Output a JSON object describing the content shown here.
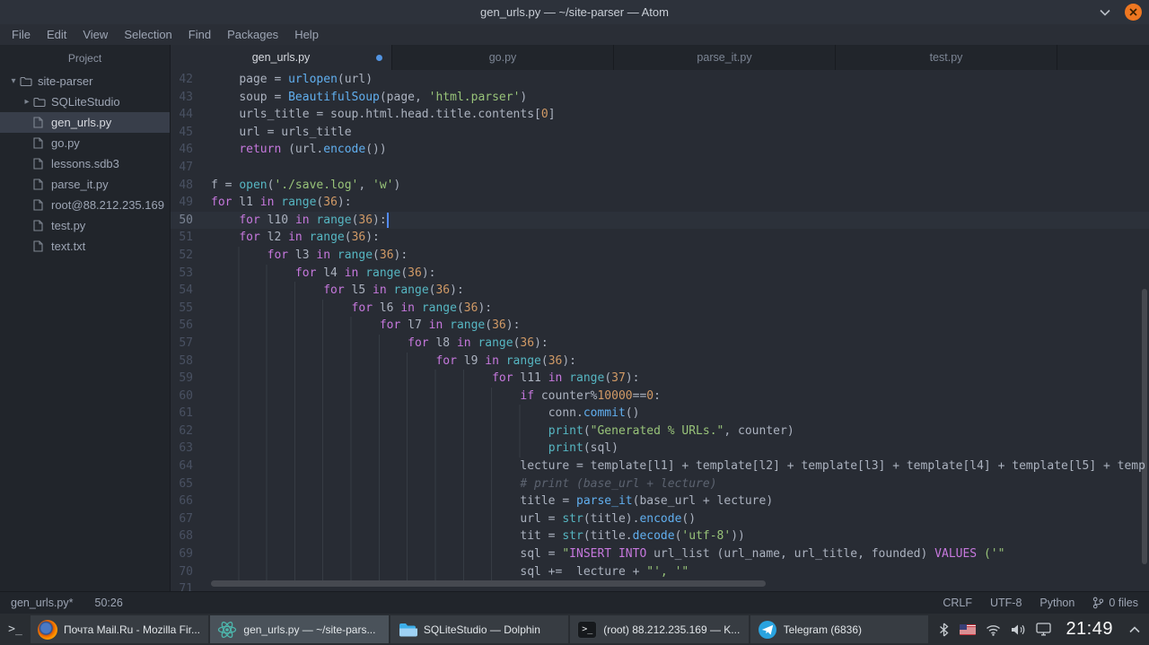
{
  "window": {
    "title": "gen_urls.py — ~/site-parser — Atom"
  },
  "theme": {
    "accent": "#528bff",
    "modified_dot": "#5294e2",
    "close_button": "#ee7721"
  },
  "menu": {
    "items": [
      "File",
      "Edit",
      "View",
      "Selection",
      "Find",
      "Packages",
      "Help"
    ]
  },
  "sidebar": {
    "header": "Project",
    "tree": [
      {
        "label": "site-parser",
        "type": "folder-open",
        "depth": 0,
        "selected": false
      },
      {
        "label": "SQLiteStudio",
        "type": "folder-collapsed",
        "depth": 1,
        "selected": false
      },
      {
        "label": "gen_urls.py",
        "type": "file",
        "depth": 1,
        "selected": true
      },
      {
        "label": "go.py",
        "type": "file",
        "depth": 1,
        "selected": false
      },
      {
        "label": "lessons.sdb3",
        "type": "file",
        "depth": 1,
        "selected": false
      },
      {
        "label": "parse_it.py",
        "type": "file",
        "depth": 1,
        "selected": false
      },
      {
        "label": "root@88.212.235.169",
        "type": "file",
        "depth": 1,
        "selected": false
      },
      {
        "label": "test.py",
        "type": "file",
        "depth": 1,
        "selected": false
      },
      {
        "label": "text.txt",
        "type": "file",
        "depth": 1,
        "selected": false
      }
    ]
  },
  "tabs": [
    {
      "label": "gen_urls.py",
      "active": true,
      "modified": true
    },
    {
      "label": "go.py",
      "active": false,
      "modified": false
    },
    {
      "label": "parse_it.py",
      "active": false,
      "modified": false
    },
    {
      "label": "test.py",
      "active": false,
      "modified": false
    }
  ],
  "editor": {
    "cursor_line": 50,
    "lines": [
      {
        "n": 42,
        "ind": 4,
        "tokens": [
          [
            "p",
            "page = "
          ],
          [
            "f",
            "urlopen"
          ],
          [
            "p",
            "(url)"
          ]
        ]
      },
      {
        "n": 43,
        "ind": 4,
        "tokens": [
          [
            "p",
            "soup = "
          ],
          [
            "f",
            "BeautifulSoup"
          ],
          [
            "p",
            "(page, "
          ],
          [
            "s",
            "'html.parser'"
          ],
          [
            "p",
            ")"
          ]
        ]
      },
      {
        "n": 44,
        "ind": 4,
        "tokens": [
          [
            "p",
            "urls_title = soup.html.head.title.contents["
          ],
          [
            "n",
            "0"
          ],
          [
            "p",
            "]"
          ]
        ]
      },
      {
        "n": 45,
        "ind": 4,
        "tokens": [
          [
            "p",
            "url = urls_title"
          ]
        ]
      },
      {
        "n": 46,
        "ind": 4,
        "tokens": [
          [
            "k",
            "return"
          ],
          [
            "p",
            " (url."
          ],
          [
            "f",
            "encode"
          ],
          [
            "p",
            "())"
          ]
        ]
      },
      {
        "n": 47,
        "ind": 0,
        "tokens": []
      },
      {
        "n": 48,
        "ind": 0,
        "tokens": [
          [
            "p",
            "f = "
          ],
          [
            "b",
            "open"
          ],
          [
            "p",
            "("
          ],
          [
            "s",
            "'./save.log'"
          ],
          [
            "p",
            ", "
          ],
          [
            "s",
            "'w'"
          ],
          [
            "p",
            ")"
          ]
        ]
      },
      {
        "n": 49,
        "ind": 0,
        "tokens": [
          [
            "k",
            "for"
          ],
          [
            "p",
            " l1 "
          ],
          [
            "k",
            "in"
          ],
          [
            "p",
            " "
          ],
          [
            "b",
            "range"
          ],
          [
            "p",
            "("
          ],
          [
            "n",
            "36"
          ],
          [
            "p",
            "):"
          ]
        ]
      },
      {
        "n": 50,
        "ind": 4,
        "cursor": 26,
        "tokens": [
          [
            "k",
            "for"
          ],
          [
            "p",
            " l10 "
          ],
          [
            "k",
            "in"
          ],
          [
            "p",
            " "
          ],
          [
            "b",
            "range"
          ],
          [
            "p",
            "("
          ],
          [
            "n",
            "36"
          ],
          [
            "p",
            "):"
          ]
        ]
      },
      {
        "n": 51,
        "ind": 4,
        "tokens": [
          [
            "k",
            "for"
          ],
          [
            "p",
            " l2 "
          ],
          [
            "k",
            "in"
          ],
          [
            "p",
            " "
          ],
          [
            "b",
            "range"
          ],
          [
            "p",
            "("
          ],
          [
            "n",
            "36"
          ],
          [
            "p",
            "):"
          ]
        ]
      },
      {
        "n": 52,
        "ind": 8,
        "tokens": [
          [
            "k",
            "for"
          ],
          [
            "p",
            " l3 "
          ],
          [
            "k",
            "in"
          ],
          [
            "p",
            " "
          ],
          [
            "b",
            "range"
          ],
          [
            "p",
            "("
          ],
          [
            "n",
            "36"
          ],
          [
            "p",
            "):"
          ]
        ]
      },
      {
        "n": 53,
        "ind": 12,
        "tokens": [
          [
            "k",
            "for"
          ],
          [
            "p",
            " l4 "
          ],
          [
            "k",
            "in"
          ],
          [
            "p",
            " "
          ],
          [
            "b",
            "range"
          ],
          [
            "p",
            "("
          ],
          [
            "n",
            "36"
          ],
          [
            "p",
            "):"
          ]
        ]
      },
      {
        "n": 54,
        "ind": 16,
        "tokens": [
          [
            "k",
            "for"
          ],
          [
            "p",
            " l5 "
          ],
          [
            "k",
            "in"
          ],
          [
            "p",
            " "
          ],
          [
            "b",
            "range"
          ],
          [
            "p",
            "("
          ],
          [
            "n",
            "36"
          ],
          [
            "p",
            "):"
          ]
        ]
      },
      {
        "n": 55,
        "ind": 20,
        "tokens": [
          [
            "k",
            "for"
          ],
          [
            "p",
            " l6 "
          ],
          [
            "k",
            "in"
          ],
          [
            "p",
            " "
          ],
          [
            "b",
            "range"
          ],
          [
            "p",
            "("
          ],
          [
            "n",
            "36"
          ],
          [
            "p",
            "):"
          ]
        ]
      },
      {
        "n": 56,
        "ind": 24,
        "tokens": [
          [
            "k",
            "for"
          ],
          [
            "p",
            " l7 "
          ],
          [
            "k",
            "in"
          ],
          [
            "p",
            " "
          ],
          [
            "b",
            "range"
          ],
          [
            "p",
            "("
          ],
          [
            "n",
            "36"
          ],
          [
            "p",
            "):"
          ]
        ]
      },
      {
        "n": 57,
        "ind": 28,
        "tokens": [
          [
            "k",
            "for"
          ],
          [
            "p",
            " l8 "
          ],
          [
            "k",
            "in"
          ],
          [
            "p",
            " "
          ],
          [
            "b",
            "range"
          ],
          [
            "p",
            "("
          ],
          [
            "n",
            "36"
          ],
          [
            "p",
            "):"
          ]
        ]
      },
      {
        "n": 58,
        "ind": 32,
        "tokens": [
          [
            "k",
            "for"
          ],
          [
            "p",
            " l9 "
          ],
          [
            "k",
            "in"
          ],
          [
            "p",
            " "
          ],
          [
            "b",
            "range"
          ],
          [
            "p",
            "("
          ],
          [
            "n",
            "36"
          ],
          [
            "p",
            "):"
          ]
        ]
      },
      {
        "n": 59,
        "ind": 40,
        "tokens": [
          [
            "k",
            "for"
          ],
          [
            "p",
            " l11 "
          ],
          [
            "k",
            "in"
          ],
          [
            "p",
            " "
          ],
          [
            "b",
            "range"
          ],
          [
            "p",
            "("
          ],
          [
            "n",
            "37"
          ],
          [
            "p",
            "):"
          ]
        ]
      },
      {
        "n": 60,
        "ind": 44,
        "tokens": [
          [
            "k",
            "if"
          ],
          [
            "p",
            " counter%"
          ],
          [
            "n",
            "10000"
          ],
          [
            "p",
            "=="
          ],
          [
            "n",
            "0"
          ],
          [
            "p",
            ":"
          ]
        ]
      },
      {
        "n": 61,
        "ind": 48,
        "tokens": [
          [
            "p",
            "conn."
          ],
          [
            "f",
            "commit"
          ],
          [
            "p",
            "()"
          ]
        ]
      },
      {
        "n": 62,
        "ind": 48,
        "tokens": [
          [
            "b",
            "print"
          ],
          [
            "p",
            "("
          ],
          [
            "s",
            "\"Generated % URLs.\""
          ],
          [
            "p",
            ", counter)"
          ]
        ]
      },
      {
        "n": 63,
        "ind": 48,
        "tokens": [
          [
            "b",
            "print"
          ],
          [
            "p",
            "(sql)"
          ]
        ]
      },
      {
        "n": 64,
        "ind": 44,
        "tokens": [
          [
            "p",
            "lecture = template[l1] + template[l2] + template[l3] + template[l4] + template[l5] + temp"
          ]
        ]
      },
      {
        "n": 65,
        "ind": 44,
        "tokens": [
          [
            "c",
            "# print (base_url + lecture)"
          ]
        ]
      },
      {
        "n": 66,
        "ind": 44,
        "tokens": [
          [
            "p",
            "title = "
          ],
          [
            "f",
            "parse_it"
          ],
          [
            "p",
            "(base_url + lecture)"
          ]
        ]
      },
      {
        "n": 67,
        "ind": 44,
        "tokens": [
          [
            "p",
            "url = "
          ],
          [
            "b",
            "str"
          ],
          [
            "p",
            "(title)."
          ],
          [
            "f",
            "encode"
          ],
          [
            "p",
            "()"
          ]
        ]
      },
      {
        "n": 68,
        "ind": 44,
        "tokens": [
          [
            "p",
            "tit = "
          ],
          [
            "b",
            "str"
          ],
          [
            "p",
            "(title."
          ],
          [
            "f",
            "decode"
          ],
          [
            "p",
            "("
          ],
          [
            "s",
            "'utf-8'"
          ],
          [
            "p",
            "))"
          ]
        ]
      },
      {
        "n": 69,
        "ind": 44,
        "tokens": [
          [
            "p",
            "sql = "
          ],
          [
            "s",
            "\""
          ],
          [
            "k",
            "INSERT INTO"
          ],
          [
            "p",
            " url_list (url_name, url_title, founded) "
          ],
          [
            "k",
            "VALUES"
          ],
          [
            "s",
            " ('\""
          ]
        ]
      },
      {
        "n": 70,
        "ind": 44,
        "tokens": [
          [
            "p",
            "sql +=  lecture + "
          ],
          [
            "s",
            "\"', '\""
          ]
        ]
      },
      {
        "n": 71,
        "ind": 0,
        "tokens": []
      }
    ]
  },
  "status": {
    "file": "gen_urls.py*",
    "cursor": "50:26",
    "right": [
      "CRLF",
      "UTF-8",
      "Python"
    ],
    "git_files": "0 files"
  },
  "taskbar": {
    "launcher_glyph": ">_",
    "tasks": [
      {
        "icon": "firefox-icon",
        "label": "Почта Mail.Ru - Mozilla Fir...",
        "active": false
      },
      {
        "icon": "atom-icon",
        "label": "gen_urls.py — ~/site-pars...",
        "active": true
      },
      {
        "icon": "dolphin-icon",
        "label": "SQLiteStudio — Dolphin",
        "active": false
      },
      {
        "icon": "konsole-icon",
        "label": "(root) 88.212.235.169 — K...",
        "active": false
      },
      {
        "icon": "telegram-icon",
        "label": "Telegram (6836)",
        "active": false
      }
    ],
    "tray": [
      "bluetooth-icon",
      "us-flag-icon",
      "network-icon",
      "volume-icon",
      "display-icon"
    ],
    "clock": "21:49"
  }
}
